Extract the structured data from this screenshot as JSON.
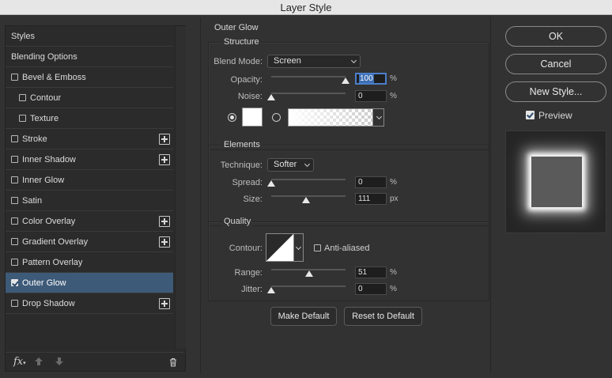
{
  "window": {
    "title": "Layer Style"
  },
  "styles_list": {
    "items": [
      {
        "label": "Styles",
        "checkbox": false,
        "checked": false,
        "indent": false,
        "plus": false,
        "selected": false
      },
      {
        "label": "Blending Options",
        "checkbox": false,
        "checked": false,
        "indent": false,
        "plus": false,
        "selected": false
      },
      {
        "label": "Bevel & Emboss",
        "checkbox": true,
        "checked": false,
        "indent": false,
        "plus": false,
        "selected": false
      },
      {
        "label": "Contour",
        "checkbox": true,
        "checked": false,
        "indent": true,
        "plus": false,
        "selected": false
      },
      {
        "label": "Texture",
        "checkbox": true,
        "checked": false,
        "indent": true,
        "plus": false,
        "selected": false
      },
      {
        "label": "Stroke",
        "checkbox": true,
        "checked": false,
        "indent": false,
        "plus": true,
        "selected": false
      },
      {
        "label": "Inner Shadow",
        "checkbox": true,
        "checked": false,
        "indent": false,
        "plus": true,
        "selected": false
      },
      {
        "label": "Inner Glow",
        "checkbox": true,
        "checked": false,
        "indent": false,
        "plus": false,
        "selected": false
      },
      {
        "label": "Satin",
        "checkbox": true,
        "checked": false,
        "indent": false,
        "plus": false,
        "selected": false
      },
      {
        "label": "Color Overlay",
        "checkbox": true,
        "checked": false,
        "indent": false,
        "plus": true,
        "selected": false
      },
      {
        "label": "Gradient Overlay",
        "checkbox": true,
        "checked": false,
        "indent": false,
        "plus": true,
        "selected": false
      },
      {
        "label": "Pattern Overlay",
        "checkbox": true,
        "checked": false,
        "indent": false,
        "plus": false,
        "selected": false
      },
      {
        "label": "Outer Glow",
        "checkbox": true,
        "checked": true,
        "indent": false,
        "plus": false,
        "selected": true
      },
      {
        "label": "Drop Shadow",
        "checkbox": true,
        "checked": false,
        "indent": false,
        "plus": true,
        "selected": false
      }
    ],
    "footer": {
      "fx_label": "fx"
    }
  },
  "outer_glow": {
    "panel_title": "Outer Glow",
    "structure": {
      "title": "Structure",
      "blend_mode_label": "Blend Mode:",
      "blend_mode_value": "Screen",
      "opacity_label": "Opacity:",
      "opacity_value": "100",
      "opacity_fraction": 1.0,
      "opacity_unit": "%",
      "noise_label": "Noise:",
      "noise_value": "0",
      "noise_fraction": 0.0,
      "noise_unit": "%",
      "glow_color": "#ffffff"
    },
    "elements": {
      "title": "Elements",
      "technique_label": "Technique:",
      "technique_value": "Softer",
      "spread_label": "Spread:",
      "spread_value": "0",
      "spread_fraction": 0.0,
      "spread_unit": "%",
      "size_label": "Size:",
      "size_value": "111",
      "size_fraction": 0.47,
      "size_unit": "px"
    },
    "quality": {
      "title": "Quality",
      "contour_label": "Contour:",
      "anti_aliased_label": "Anti-aliased",
      "anti_aliased_checked": false,
      "range_label": "Range:",
      "range_value": "51",
      "range_fraction": 0.51,
      "range_unit": "%",
      "jitter_label": "Jitter:",
      "jitter_value": "0",
      "jitter_fraction": 0.0,
      "jitter_unit": "%"
    },
    "make_default_label": "Make Default",
    "reset_default_label": "Reset to Default"
  },
  "actions": {
    "ok_label": "OK",
    "cancel_label": "Cancel",
    "new_style_label": "New Style...",
    "preview_label": "Preview",
    "preview_checked": true
  },
  "colors": {
    "selection": "#3d5a78",
    "field_highlight": "#4b7fcb"
  }
}
